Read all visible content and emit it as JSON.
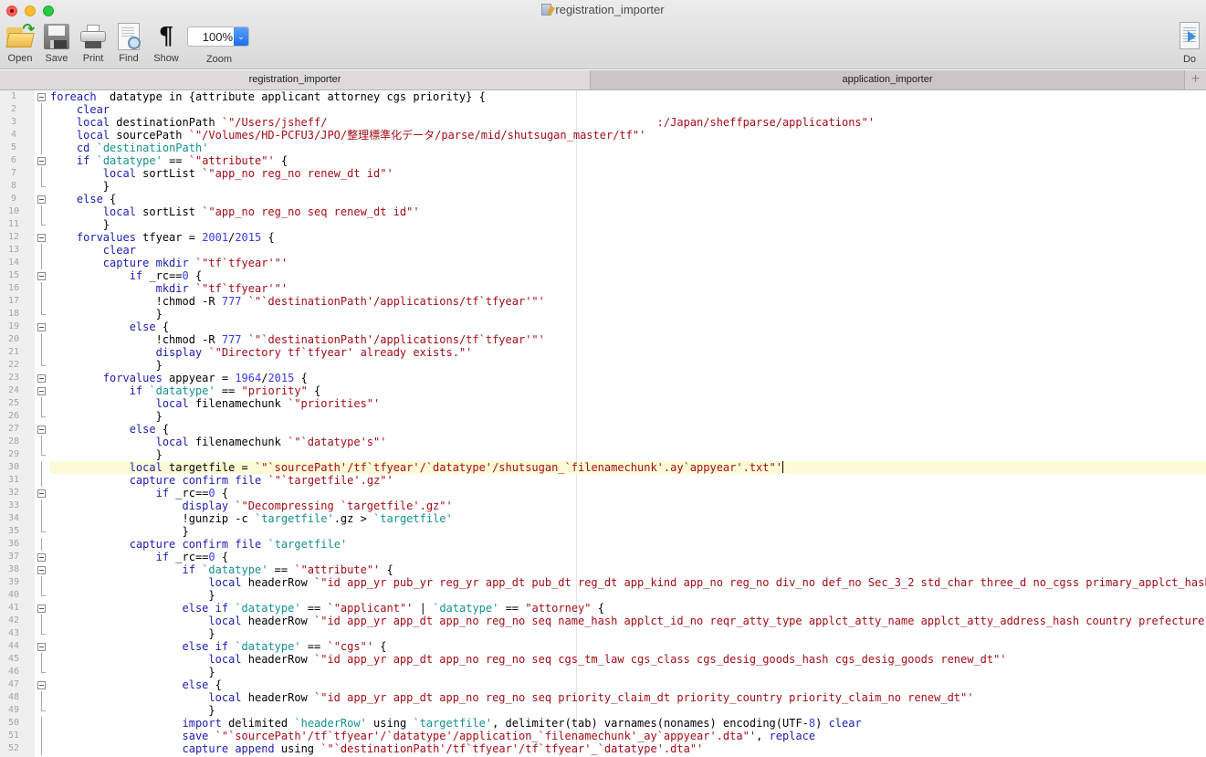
{
  "window": {
    "title": "registration_importer"
  },
  "toolbar": {
    "open_label": "Open",
    "save_label": "Save",
    "print_label": "Print",
    "find_label": "Find",
    "show_label": "Show",
    "zoom_label": "Zoom",
    "zoom_value": "100%",
    "do_label": "Do",
    "show_glyph": "¶"
  },
  "tabs": [
    {
      "label": "registration_importer",
      "active": true
    },
    {
      "label": "application_importer",
      "active": false
    }
  ],
  "tab_add_glyph": "+",
  "editor": {
    "current_line": 30,
    "lines": [
      {
        "n": "1",
        "fold": "start",
        "indent": 0,
        "tokens": [
          [
            "kw",
            "foreach"
          ],
          [
            "",
            "  datatype in {attribute applicant attorney cgs priority} {"
          ]
        ]
      },
      {
        "n": "2",
        "fold": "line",
        "indent": 1,
        "tokens": [
          [
            "kw",
            "clear"
          ]
        ]
      },
      {
        "n": "3",
        "fold": "line",
        "indent": 1,
        "tokens": [
          [
            "kw",
            "local"
          ],
          [
            "",
            " destinationPath "
          ],
          [
            "str",
            "`\"/Users/jsheff/                                                  :/Japan/sheffparse/applications\"'"
          ]
        ]
      },
      {
        "n": "4",
        "fold": "line",
        "indent": 1,
        "tokens": [
          [
            "kw",
            "local"
          ],
          [
            "",
            " sourcePath "
          ],
          [
            "str",
            "`\"/Volumes/HD-PCFU3/JPO/整理標準化データ/parse/mid/shutsugan_master/tf\"'"
          ]
        ]
      },
      {
        "n": "5",
        "fold": "line",
        "indent": 1,
        "tokens": [
          [
            "kw",
            "cd"
          ],
          [
            "",
            " "
          ],
          [
            "mac",
            "`destinationPath'"
          ]
        ]
      },
      {
        "n": "6",
        "fold": "start",
        "indent": 1,
        "tokens": [
          [
            "kw",
            "if"
          ],
          [
            "",
            " "
          ],
          [
            "mac",
            "`datatype'"
          ],
          [
            "",
            " == "
          ],
          [
            "str",
            "`\"attribute\"'"
          ],
          [
            "",
            " {"
          ]
        ]
      },
      {
        "n": "7",
        "fold": "line",
        "indent": 2,
        "tokens": [
          [
            "kw",
            "local"
          ],
          [
            "",
            " sortList "
          ],
          [
            "str",
            "`\"app_no reg_no renew_dt id\"'"
          ]
        ]
      },
      {
        "n": "8",
        "fold": "end",
        "indent": 2,
        "tokens": [
          [
            "",
            "}"
          ]
        ]
      },
      {
        "n": "9",
        "fold": "start",
        "indent": 1,
        "tokens": [
          [
            "kw",
            "else"
          ],
          [
            "",
            " {"
          ]
        ]
      },
      {
        "n": "10",
        "fold": "line",
        "indent": 2,
        "tokens": [
          [
            "kw",
            "local"
          ],
          [
            "",
            " sortList "
          ],
          [
            "str",
            "`\"app_no reg_no seq renew_dt id\"'"
          ]
        ]
      },
      {
        "n": "11",
        "fold": "end",
        "indent": 2,
        "tokens": [
          [
            "",
            "}"
          ]
        ]
      },
      {
        "n": "12",
        "fold": "start",
        "indent": 1,
        "tokens": [
          [
            "kw",
            "forvalues"
          ],
          [
            "",
            " tfyear = "
          ],
          [
            "num",
            "2001"
          ],
          [
            "",
            "/"
          ],
          [
            "num",
            "2015"
          ],
          [
            "",
            " {"
          ]
        ]
      },
      {
        "n": "13",
        "fold": "line",
        "indent": 2,
        "tokens": [
          [
            "kw",
            "clear"
          ]
        ]
      },
      {
        "n": "14",
        "fold": "line",
        "indent": 2,
        "tokens": [
          [
            "kw",
            "capture"
          ],
          [
            "",
            " "
          ],
          [
            "kw",
            "mkdir"
          ],
          [
            "",
            " "
          ],
          [
            "str",
            "`\"tf`tfyear'\"'"
          ]
        ]
      },
      {
        "n": "15",
        "fold": "start",
        "indent": 3,
        "tokens": [
          [
            "kw",
            "if"
          ],
          [
            "",
            " _rc=="
          ],
          [
            "num",
            "0"
          ],
          [
            "",
            " {"
          ]
        ]
      },
      {
        "n": "16",
        "fold": "line",
        "indent": 4,
        "tokens": [
          [
            "kw",
            "mkdir"
          ],
          [
            "",
            " "
          ],
          [
            "str",
            "`\"tf`tfyear'\"'"
          ]
        ]
      },
      {
        "n": "17",
        "fold": "line",
        "indent": 4,
        "tokens": [
          [
            "",
            "!chmod -R "
          ],
          [
            "num",
            "777"
          ],
          [
            "",
            " "
          ],
          [
            "str",
            "`\"`destinationPath'/applications/tf`tfyear'\"'"
          ]
        ]
      },
      {
        "n": "18",
        "fold": "end",
        "indent": 4,
        "tokens": [
          [
            "",
            "}"
          ]
        ]
      },
      {
        "n": "19",
        "fold": "start",
        "indent": 3,
        "tokens": [
          [
            "kw",
            "else"
          ],
          [
            "",
            " {"
          ]
        ]
      },
      {
        "n": "20",
        "fold": "line",
        "indent": 4,
        "tokens": [
          [
            "",
            "!chmod -R "
          ],
          [
            "num",
            "777"
          ],
          [
            "",
            " "
          ],
          [
            "str",
            "`\"`destinationPath'/applications/tf`tfyear'\"'"
          ]
        ]
      },
      {
        "n": "21",
        "fold": "line",
        "indent": 4,
        "tokens": [
          [
            "kw",
            "display"
          ],
          [
            "",
            " "
          ],
          [
            "str",
            "`\"Directory tf`tfyear' already exists.\"'"
          ]
        ]
      },
      {
        "n": "22",
        "fold": "end",
        "indent": 4,
        "tokens": [
          [
            "",
            "}"
          ]
        ]
      },
      {
        "n": "23",
        "fold": "start",
        "indent": 2,
        "tokens": [
          [
            "kw",
            "forvalues"
          ],
          [
            "",
            " appyear = "
          ],
          [
            "num",
            "1964"
          ],
          [
            "",
            "/"
          ],
          [
            "num",
            "2015"
          ],
          [
            "",
            " {"
          ]
        ]
      },
      {
        "n": "24",
        "fold": "start",
        "indent": 3,
        "tokens": [
          [
            "kw",
            "if"
          ],
          [
            "",
            " "
          ],
          [
            "mac",
            "`datatype'"
          ],
          [
            "",
            " == "
          ],
          [
            "str",
            "\"priority\""
          ],
          [
            "",
            " {"
          ]
        ]
      },
      {
        "n": "25",
        "fold": "line",
        "indent": 4,
        "tokens": [
          [
            "kw",
            "local"
          ],
          [
            "",
            " filenamechunk "
          ],
          [
            "str",
            "`\"priorities\"'"
          ]
        ]
      },
      {
        "n": "26",
        "fold": "end",
        "indent": 4,
        "tokens": [
          [
            "",
            "}"
          ]
        ]
      },
      {
        "n": "27",
        "fold": "start",
        "indent": 3,
        "tokens": [
          [
            "kw",
            "else"
          ],
          [
            "",
            " {"
          ]
        ]
      },
      {
        "n": "28",
        "fold": "line",
        "indent": 4,
        "tokens": [
          [
            "kw",
            "local"
          ],
          [
            "",
            " filenamechunk "
          ],
          [
            "str",
            "`\"`datatype's\"'"
          ]
        ]
      },
      {
        "n": "29",
        "fold": "end",
        "indent": 4,
        "tokens": [
          [
            "",
            "}"
          ]
        ]
      },
      {
        "n": "30",
        "fold": "line",
        "indent": 3,
        "tokens": [
          [
            "kw",
            "local"
          ],
          [
            "",
            " targetfile = "
          ],
          [
            "str",
            "`\"`sourcePath'/tf`tfyear'/`datatype'/shutsugan_`filenamechunk'.ay`appyear'.txt\"'"
          ]
        ]
      },
      {
        "n": "31",
        "fold": "line",
        "indent": 3,
        "tokens": [
          [
            "kw",
            "capture"
          ],
          [
            "",
            " "
          ],
          [
            "kw",
            "confirm"
          ],
          [
            "",
            " "
          ],
          [
            "kw",
            "file"
          ],
          [
            "",
            " "
          ],
          [
            "str",
            "`\"`targetfile'.gz\"'"
          ]
        ]
      },
      {
        "n": "32",
        "fold": "start",
        "indent": 4,
        "tokens": [
          [
            "kw",
            "if"
          ],
          [
            "",
            " _rc=="
          ],
          [
            "num",
            "0"
          ],
          [
            "",
            " {"
          ]
        ]
      },
      {
        "n": "33",
        "fold": "line",
        "indent": 5,
        "tokens": [
          [
            "kw",
            "display"
          ],
          [
            "",
            " "
          ],
          [
            "str",
            "`\"Decompressing `targetfile'.gz\"'"
          ]
        ]
      },
      {
        "n": "34",
        "fold": "line",
        "indent": 5,
        "tokens": [
          [
            "",
            "!gunzip -c "
          ],
          [
            "mac",
            "`targetfile'"
          ],
          [
            "",
            ".gz > "
          ],
          [
            "mac",
            "`targetfile'"
          ]
        ]
      },
      {
        "n": "35",
        "fold": "end",
        "indent": 5,
        "tokens": [
          [
            "",
            "}"
          ]
        ]
      },
      {
        "n": "36",
        "fold": "line",
        "indent": 3,
        "tokens": [
          [
            "kw",
            "capture"
          ],
          [
            "",
            " "
          ],
          [
            "kw",
            "confirm"
          ],
          [
            "",
            " "
          ],
          [
            "kw",
            "file"
          ],
          [
            "",
            " "
          ],
          [
            "mac",
            "`targetfile'"
          ]
        ]
      },
      {
        "n": "37",
        "fold": "start",
        "indent": 4,
        "tokens": [
          [
            "kw",
            "if"
          ],
          [
            "",
            " _rc=="
          ],
          [
            "num",
            "0"
          ],
          [
            "",
            " {"
          ]
        ]
      },
      {
        "n": "38",
        "fold": "start",
        "indent": 5,
        "tokens": [
          [
            "kw",
            "if"
          ],
          [
            "",
            " "
          ],
          [
            "mac",
            "`datatype'"
          ],
          [
            "",
            " == "
          ],
          [
            "str",
            "`\"attribute\"'"
          ],
          [
            "",
            " {"
          ]
        ]
      },
      {
        "n": "39",
        "fold": "line",
        "indent": 6,
        "tokens": [
          [
            "kw",
            "local"
          ],
          [
            "",
            " headerRow "
          ],
          [
            "str",
            "`\"id app_yr pub_yr reg_yr app_dt pub_dt reg_dt app_kind app_no reg_no div_no def_no Sec_3_2 std_char three_d no_cgss primary_applct_hash"
          ]
        ]
      },
      {
        "n": "40",
        "fold": "end",
        "indent": 6,
        "tokens": [
          [
            "",
            "}"
          ]
        ]
      },
      {
        "n": "41",
        "fold": "start",
        "indent": 5,
        "tokens": [
          [
            "kw",
            "else"
          ],
          [
            "",
            " "
          ],
          [
            "kw",
            "if"
          ],
          [
            "",
            " "
          ],
          [
            "mac",
            "`datatype'"
          ],
          [
            "",
            " == "
          ],
          [
            "str",
            "`\"applicant\"'"
          ],
          [
            "",
            " | "
          ],
          [
            "mac",
            "`datatype'"
          ],
          [
            "",
            " == "
          ],
          [
            "str",
            "\"attorney\""
          ],
          [
            "",
            " {"
          ]
        ]
      },
      {
        "n": "42",
        "fold": "line",
        "indent": 6,
        "tokens": [
          [
            "kw",
            "local"
          ],
          [
            "",
            " headerRow "
          ],
          [
            "str",
            "`\"id app_yr app_dt app_no reg_no seq name_hash applct_id_no reqr_atty_type applct_atty_name applct_atty_address_hash country prefecture"
          ]
        ]
      },
      {
        "n": "43",
        "fold": "end",
        "indent": 6,
        "tokens": [
          [
            "",
            "}"
          ]
        ]
      },
      {
        "n": "44",
        "fold": "start",
        "indent": 5,
        "tokens": [
          [
            "kw",
            "else"
          ],
          [
            "",
            " "
          ],
          [
            "kw",
            "if"
          ],
          [
            "",
            " "
          ],
          [
            "mac",
            "`datatype'"
          ],
          [
            "",
            " == "
          ],
          [
            "str",
            "`\"cgs\"'"
          ],
          [
            "",
            " {"
          ]
        ]
      },
      {
        "n": "45",
        "fold": "line",
        "indent": 6,
        "tokens": [
          [
            "kw",
            "local"
          ],
          [
            "",
            " headerRow "
          ],
          [
            "str",
            "`\"id app_yr app_dt app_no reg_no seq cgs_tm_law cgs_class cgs_desig_goods_hash cgs_desig_goods renew_dt\"'"
          ]
        ]
      },
      {
        "n": "46",
        "fold": "end",
        "indent": 6,
        "tokens": [
          [
            "",
            "}"
          ]
        ]
      },
      {
        "n": "47",
        "fold": "start",
        "indent": 5,
        "tokens": [
          [
            "kw",
            "else"
          ],
          [
            "",
            " {"
          ]
        ]
      },
      {
        "n": "48",
        "fold": "line",
        "indent": 6,
        "tokens": [
          [
            "kw",
            "local"
          ],
          [
            "",
            " headerRow "
          ],
          [
            "str",
            "`\"id app_yr app_dt app_no reg_no seq priority_claim_dt priority_country priority_claim_no renew_dt\"'"
          ]
        ]
      },
      {
        "n": "49",
        "fold": "end",
        "indent": 6,
        "tokens": [
          [
            "",
            "}"
          ]
        ]
      },
      {
        "n": "50",
        "fold": "line",
        "indent": 5,
        "tokens": [
          [
            "kw",
            "import"
          ],
          [
            "",
            " delimited "
          ],
          [
            "mac",
            "`headerRow'"
          ],
          [
            "",
            " using "
          ],
          [
            "mac",
            "`targetfile'"
          ],
          [
            "",
            ", delimiter(tab) varnames(nonames) encoding(UTF-"
          ],
          [
            "num",
            "8"
          ],
          [
            "",
            ") "
          ],
          [
            "kw",
            "clear"
          ]
        ]
      },
      {
        "n": "51",
        "fold": "line",
        "indent": 5,
        "tokens": [
          [
            "kw",
            "save"
          ],
          [
            "",
            " "
          ],
          [
            "str",
            "`\"`sourcePath'/tf`tfyear'/`datatype'/application_`filenamechunk'_ay`appyear'.dta\"'"
          ],
          [
            "",
            ", "
          ],
          [
            "kw",
            "replace"
          ]
        ]
      },
      {
        "n": "52",
        "fold": "line",
        "indent": 5,
        "tokens": [
          [
            "kw",
            "capture"
          ],
          [
            "",
            " "
          ],
          [
            "kw",
            "append"
          ],
          [
            "",
            " using "
          ],
          [
            "str",
            "`\"`destinationPath'/tf`tfyear'/tf`tfyear'_`datatype'.dta\"'"
          ]
        ]
      }
    ]
  }
}
